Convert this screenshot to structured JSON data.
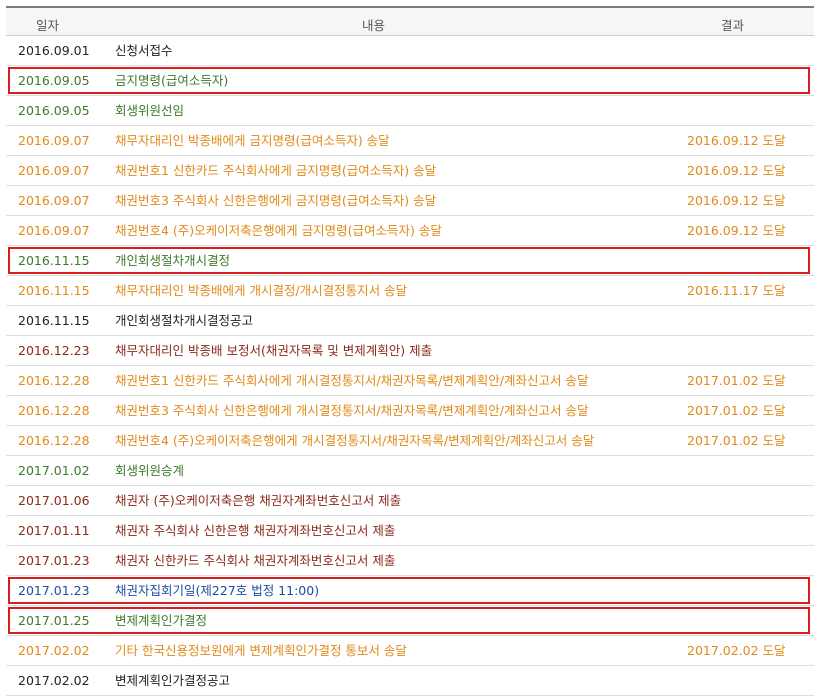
{
  "header": {
    "date": "일자",
    "content": "내용",
    "result": "결과"
  },
  "rows": [
    {
      "date": "2016.09.01",
      "content": "신청서접수",
      "result": "",
      "color": "black"
    },
    {
      "date": "2016.09.05",
      "content": "금지명령(급여소득자)",
      "result": "",
      "color": "green"
    },
    {
      "date": "2016.09.05",
      "content": "회생위원선임",
      "result": "",
      "color": "green"
    },
    {
      "date": "2016.09.07",
      "content": "채무자대리인 박종배에게 금지명령(급여소득자) 송달",
      "result": "2016.09.12 도달",
      "color": "orange"
    },
    {
      "date": "2016.09.07",
      "content": "채권번호1 신한카드 주식회사에게 금지명령(급여소득자) 송달",
      "result": "2016.09.12 도달",
      "color": "orange"
    },
    {
      "date": "2016.09.07",
      "content": "채권번호3 주식회사 신한은행에게 금지명령(급여소득자) 송달",
      "result": "2016.09.12 도달",
      "color": "orange"
    },
    {
      "date": "2016.09.07",
      "content": "채권번호4 (주)오케이저축은행에게 금지명령(급여소득자) 송달",
      "result": "2016.09.12 도달",
      "color": "orange"
    },
    {
      "date": "2016.11.15",
      "content": "개인회생절차개시결정",
      "result": "",
      "color": "green"
    },
    {
      "date": "2016.11.15",
      "content": "채무자대리인 박종배에게 개시결정/개시결정통지서 송달",
      "result": "2016.11.17 도달",
      "color": "orange"
    },
    {
      "date": "2016.11.15",
      "content": "개인회생절차개시결정공고",
      "result": "",
      "color": "black"
    },
    {
      "date": "2016.12.23",
      "content": "채무자대리인 박종배 보정서(채권자목록 및 변제계획안) 제출",
      "result": "",
      "color": "brown"
    },
    {
      "date": "2016.12.28",
      "content": "채권번호1 신한카드 주식회사에게 개시결정통지서/채권자목록/변제계획안/계좌신고서 송달",
      "result": "2017.01.02 도달",
      "color": "orange"
    },
    {
      "date": "2016.12.28",
      "content": "채권번호3 주식회사 신한은행에게 개시결정통지서/채권자목록/변제계획안/계좌신고서 송달",
      "result": "2017.01.02 도달",
      "color": "orange"
    },
    {
      "date": "2016.12.28",
      "content": "채권번호4 (주)오케이저축은행에게 개시결정통지서/채권자목록/변제계획안/계좌신고서 송달",
      "result": "2017.01.02 도달",
      "color": "orange"
    },
    {
      "date": "2017.01.02",
      "content": "회생위원승계",
      "result": "",
      "color": "green"
    },
    {
      "date": "2017.01.06",
      "content": "채권자 (주)오케이저축은행 채권자계좌번호신고서 제출",
      "result": "",
      "color": "brown"
    },
    {
      "date": "2017.01.11",
      "content": "채권자 주식회사 신한은행 채권자계좌번호신고서 제출",
      "result": "",
      "color": "brown"
    },
    {
      "date": "2017.01.23",
      "content": "채권자 신한카드 주식회사 채권자계좌번호신고서 제출",
      "result": "",
      "color": "brown"
    },
    {
      "date": "2017.01.23",
      "content": "채권자집회기일(제227호 법정 11:00)",
      "result": "",
      "color": "blue"
    },
    {
      "date": "2017.01.25",
      "content": "변제계획인가결정",
      "result": "",
      "color": "green"
    },
    {
      "date": "2017.02.02",
      "content": "기타 한국신용정보원에게 변제계획인가결정 통보서 송달",
      "result": "2017.02.02 도달",
      "color": "orange"
    },
    {
      "date": "2017.02.02",
      "content": "변제계획인가결정공고",
      "result": "",
      "color": "black"
    }
  ],
  "highlight_color": "#d91d1d",
  "highlighted_rows": [
    1,
    7,
    18,
    19
  ]
}
